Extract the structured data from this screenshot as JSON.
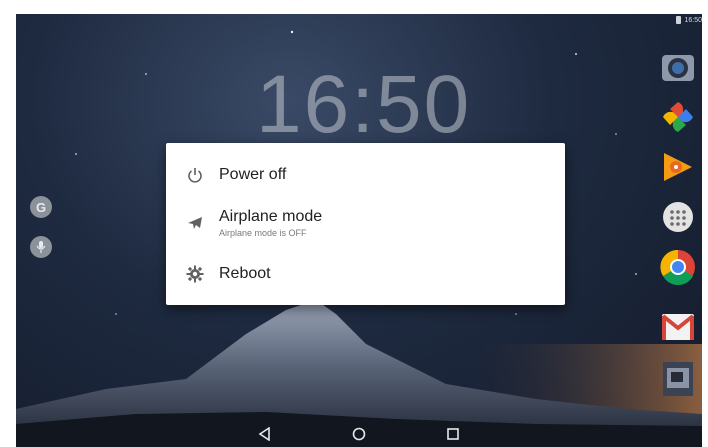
{
  "status_bar": {
    "time": "16:50"
  },
  "lock_clock": "16:50",
  "power_menu": {
    "items": [
      {
        "label": "Power off",
        "icon": "power-icon"
      },
      {
        "label": "Airplane mode",
        "sublabel": "Airplane mode is OFF",
        "icon": "airplane-icon"
      },
      {
        "label": "Reboot",
        "icon": "reboot-icon"
      }
    ]
  },
  "left_shortcuts": [
    {
      "icon": "google-icon",
      "glyph": "G"
    },
    {
      "icon": "microphone-icon",
      "glyph": "🎤"
    }
  ],
  "dock_apps": [
    {
      "icon": "camera-icon",
      "color": "#7f8fa6"
    },
    {
      "icon": "photos-icon",
      "color": "#e05a3a"
    },
    {
      "icon": "play-music-icon",
      "color": "#f08a00"
    },
    {
      "icon": "app-drawer-icon",
      "color": "#d8d8d8"
    },
    {
      "icon": "chrome-icon",
      "color": "#4c8bf5"
    },
    {
      "icon": "gmail-icon",
      "color": "#d44638"
    },
    {
      "icon": "gallery-icon",
      "color": "#505868"
    }
  ],
  "navigation": {
    "back": "back-icon",
    "home": "home-icon",
    "recents": "recents-icon"
  }
}
